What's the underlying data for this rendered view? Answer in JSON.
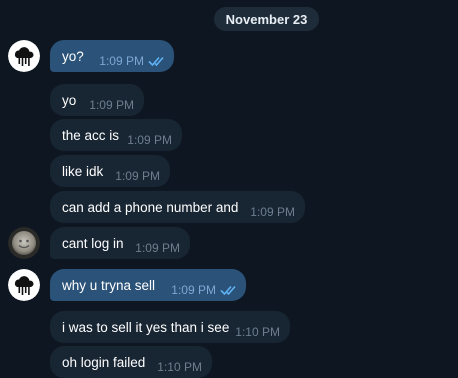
{
  "date_label": "November 23",
  "colors": {
    "background": "#0e1621",
    "incoming_bubble": "#182533",
    "outgoing_bubble": "#2b5278",
    "time_incoming": "#6d7f8f",
    "time_outgoing": "#7da8d3",
    "read_check": "#5fb3f5"
  },
  "messages": [
    {
      "text": "yo?",
      "time": "1:09 PM",
      "direction": "outgoing",
      "read": true,
      "avatar": "cloud-logo-icon"
    },
    {
      "text": "yo",
      "time": "1:09 PM",
      "direction": "incoming"
    },
    {
      "text": "the acc is",
      "time": "1:09 PM",
      "direction": "incoming"
    },
    {
      "text": "like idk",
      "time": "1:09 PM",
      "direction": "incoming"
    },
    {
      "text": "can add a phone number and",
      "time": "1:09 PM",
      "direction": "incoming"
    },
    {
      "text": "cant log in",
      "time": "1:09 PM",
      "direction": "incoming",
      "avatar": "user-photo-avatar"
    },
    {
      "text": "why u tryna sell",
      "time": "1:09 PM",
      "direction": "outgoing",
      "read": true,
      "avatar": "cloud-logo-icon"
    },
    {
      "text": "i was to sell it yes than i see",
      "time": "1:10 PM",
      "direction": "incoming"
    },
    {
      "text": "oh login failed",
      "time": "1:10 PM",
      "direction": "incoming"
    }
  ]
}
